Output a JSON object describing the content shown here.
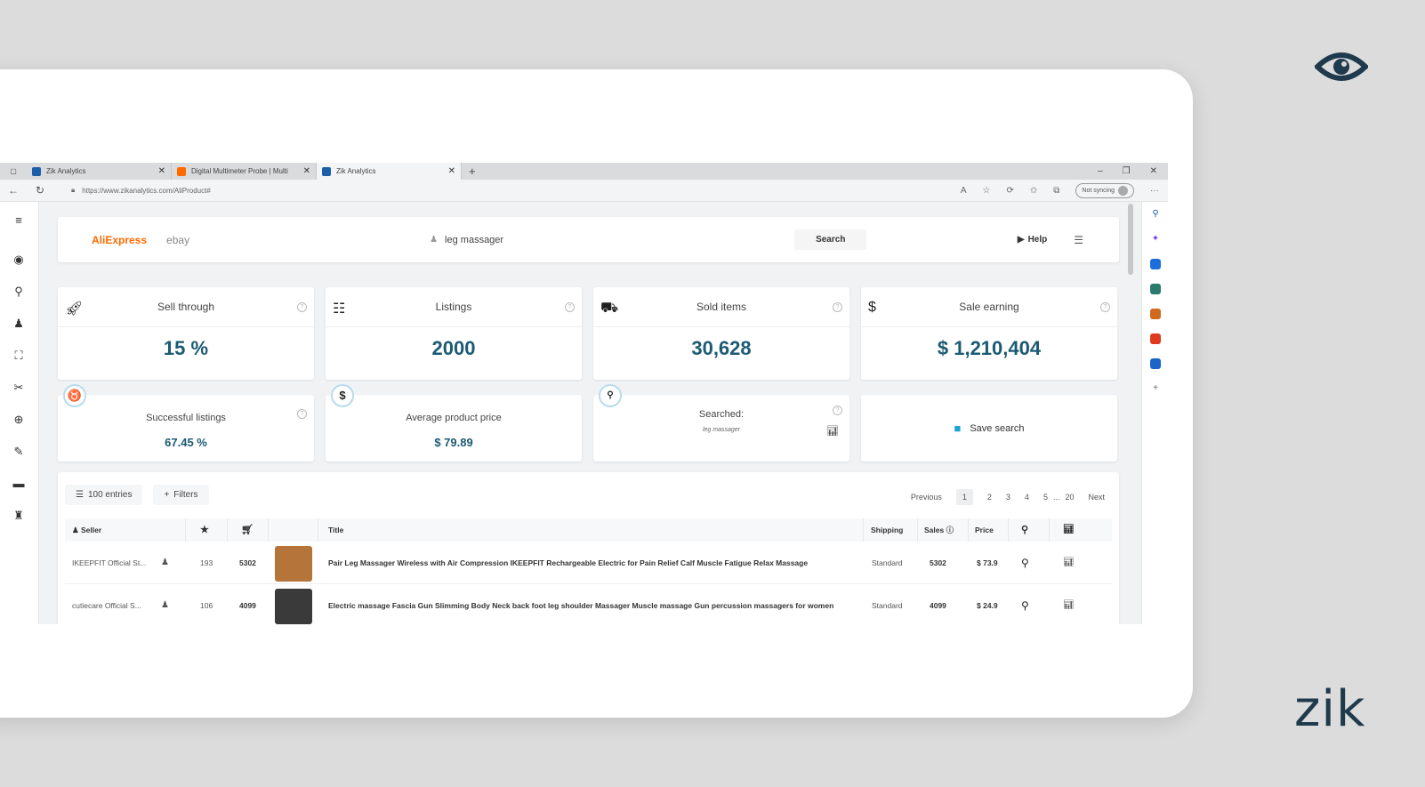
{
  "overlay": {
    "logo_text": "zik",
    "eye_icon": "eye-icon",
    "colors": {
      "brand_dark": "#1f3a4d",
      "accent_teal": "#1a5a73",
      "aliexpress_orange": "#ff6a00"
    }
  },
  "browser": {
    "tabs": [
      {
        "title": "Zik Analytics",
        "favicon_color": "#1c5fa8",
        "active": false
      },
      {
        "title": "Digital Multimeter Probe | Multi",
        "favicon_color": "#ff6a00",
        "active": false
      },
      {
        "title": "Zik Analytics",
        "favicon_color": "#1c5fa8",
        "active": true
      }
    ],
    "new_tab": "+",
    "url": "https://www.zikanalytics.com/AliProduct#",
    "sync_label": "Not syncing"
  },
  "app": {
    "markets": {
      "aliexpress": "AliExpress",
      "ebay": "ebay"
    },
    "search_query": "leg massager",
    "search_button": "Search",
    "help_button": "Help",
    "stats": [
      {
        "label": "Sell through",
        "value": "15 %",
        "icon": "rocket-icon"
      },
      {
        "label": "Listings",
        "value": "2000",
        "icon": "list-icon"
      },
      {
        "label": "Sold items",
        "value": "30,628",
        "icon": "basket-icon"
      },
      {
        "label": "Sale earning",
        "value": "$ 1,210,404",
        "icon": "hand-dollar-icon"
      }
    ],
    "substats": {
      "successful": {
        "label": "Successful listings",
        "value": "67.45 %"
      },
      "avg_price": {
        "label": "Average product price",
        "value": "$ 79.89"
      },
      "searched": {
        "label": "Searched:",
        "value": "leg massager"
      },
      "save": {
        "label": "Save search"
      }
    },
    "table": {
      "entries_label": "100 entries",
      "filters_label": "Filters",
      "pager": {
        "previous": "Previous",
        "pages": [
          "1",
          "2",
          "3",
          "4",
          "5"
        ],
        "ellipsis": "...",
        "last": "20",
        "next": "Next"
      },
      "headers": {
        "seller": "Seller",
        "title": "Title",
        "shipping": "Shipping",
        "sales": "Sales",
        "price": "Price"
      },
      "rows": [
        {
          "seller": "IKEEPFIT Official St...",
          "rating": "193",
          "orders": "5302",
          "title": "Pair Leg Massager Wireless with Air Compression IKEEPFIT Rechargeable Electric for Pain Relief Calf Muscle Fatigue Relax Massage",
          "shipping": "Standard",
          "sales": "5302",
          "price": "$ 73.9",
          "thumb_color": "#b5743a"
        },
        {
          "seller": "cutiecare Official S...",
          "rating": "106",
          "orders": "4099",
          "title": "Electric massage Fascia Gun Slimming Body Neck back foot leg shoulder Massager Muscle massage Gun percussion massagers for women",
          "shipping": "Standard",
          "sales": "4099",
          "price": "$ 24.9",
          "thumb_color": "#3a3a3a"
        }
      ]
    }
  }
}
